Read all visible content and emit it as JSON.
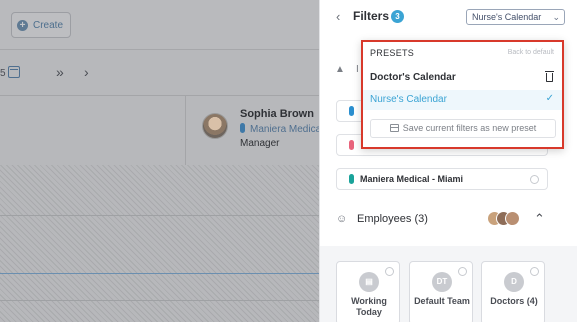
{
  "background": {
    "create_label": "Create",
    "nav_number": "5",
    "nav_next_fast": "»",
    "nav_next": "›",
    "employee": {
      "name": "Sophia Brown",
      "location": "Maniera Medica",
      "role": "Manager"
    }
  },
  "filters": {
    "title": "Filters",
    "count": "3",
    "preset_selected": "Nurse's Calendar",
    "row_partial_label": "I",
    "locations": [
      {
        "label": "",
        "color": "#2b8fcf"
      },
      {
        "label": "",
        "color": "#e8637b"
      },
      {
        "label": "Maniera Medical - Miami",
        "color": "#1aa39a"
      }
    ],
    "employees_label": "Employees (3)",
    "teams": [
      {
        "initials": "",
        "name": "Working Today"
      },
      {
        "initials": "DT",
        "name": "Default Team"
      },
      {
        "initials": "D",
        "name": "Doctors (4)"
      }
    ]
  },
  "presets": {
    "title": "PRESETS",
    "back_to_default": "Back to default",
    "items": [
      {
        "label": "Doctor's Calendar",
        "active": false
      },
      {
        "label": "Nurse's Calendar",
        "active": true
      }
    ],
    "save_label": "Save current filters as new preset"
  },
  "colors": {
    "accent": "#3ba4d4",
    "highlight_border": "#d8392b"
  },
  "icons": {
    "back": "chevron-left-icon",
    "dropdown": "chevron-down-icon",
    "delete": "trash-icon",
    "selected": "check-icon",
    "save": "calendar-plus-icon",
    "employees": "people-icon",
    "collapse": "chevron-up-icon"
  }
}
